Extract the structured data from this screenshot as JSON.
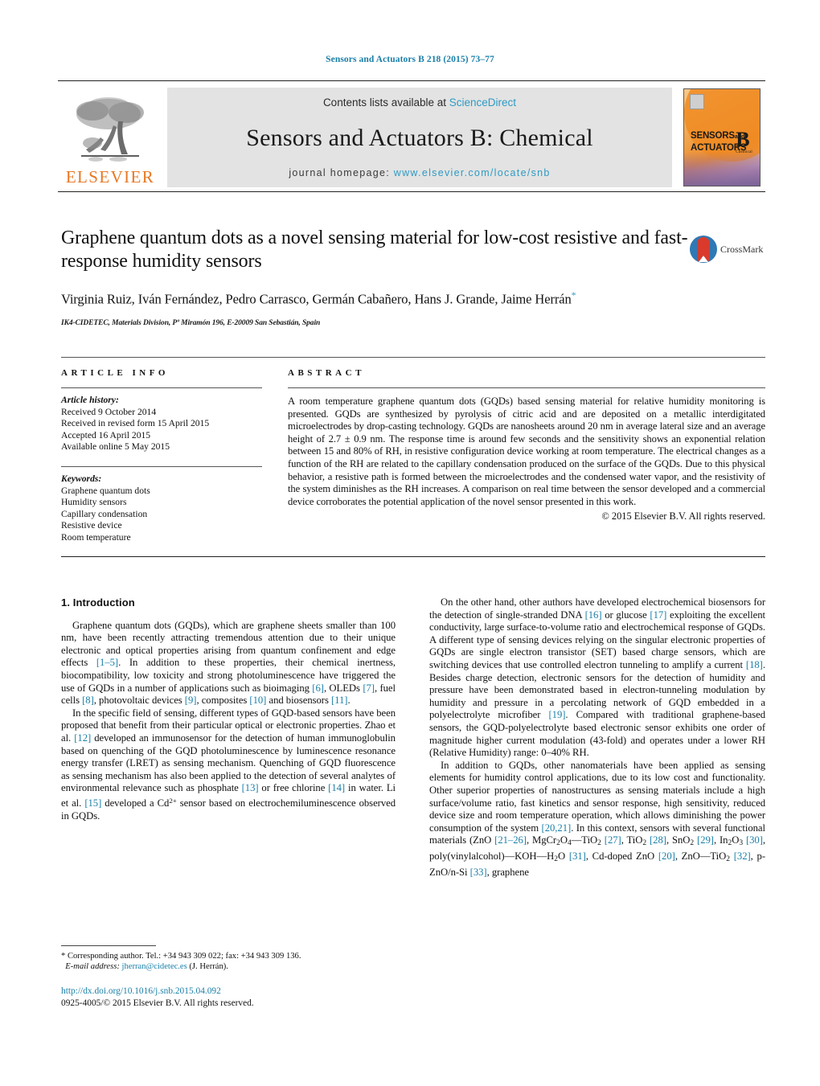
{
  "running_head": "Sensors and Actuators B 218 (2015) 73–77",
  "masthead": {
    "publisher_logo_text": "ELSEVIER",
    "contents_prefix": "Contents lists available at ",
    "contents_link": "ScienceDirect",
    "journal_title": "Sensors and Actuators B: Chemical",
    "homepage_prefix": "journal homepage: ",
    "homepage_url": "www.elsevier.com/locate/snb",
    "cover": {
      "line1": "SENSORS",
      "line1_suffix": "and",
      "line2": "ACTUATORS",
      "series": "B",
      "series_sub": "Chemical"
    }
  },
  "article": {
    "title": "Graphene quantum dots as a novel sensing material for low-cost resistive and fast-response humidity sensors",
    "authors": "Virginia Ruiz, Iván Fernández, Pedro Carrasco, Germán Cabañero, Hans J. Grande, Jaime Herrán",
    "corresponding_marker": "*",
    "affiliation": "IK4-CIDETEC, Materials Division, Pº Miramón 196, E-20009 San Sebastián, Spain",
    "crossmark_label": "CrossMark"
  },
  "article_info": {
    "heading": "ARTICLE INFO",
    "history_label": "Article history:",
    "history": [
      "Received 9 October 2014",
      "Received in revised form 15 April 2015",
      "Accepted 16 April 2015",
      "Available online 5 May 2015"
    ],
    "keywords_label": "Keywords:",
    "keywords": [
      "Graphene quantum dots",
      "Humidity sensors",
      "Capillary condensation",
      "Resistive device",
      "Room temperature"
    ]
  },
  "abstract": {
    "heading": "ABSTRACT",
    "text": "A room temperature graphene quantum dots (GQDs) based sensing material for relative humidity monitoring is presented. GQDs are synthesized by pyrolysis of citric acid and are deposited on a metallic interdigitated microelectrodes by drop-casting technology. GQDs are nanosheets around 20 nm in average lateral size and an average height of 2.7 ± 0.9 nm. The response time is around few seconds and the sensitivity shows an exponential relation between 15 and 80% of RH, in resistive configuration device working at room temperature. The electrical changes as a function of the RH are related to the capillary condensation produced on the surface of the GQDs. Due to this physical behavior, a resistive path is formed between the microelectrodes and the condensed water vapor, and the resistivity of the system diminishes as the RH increases. A comparison on real time between the sensor developed and a commercial device corroborates the potential application of the novel sensor presented in this work.",
    "copyright": "© 2015 Elsevier B.V. All rights reserved."
  },
  "body": {
    "section_title": "1.  Introduction",
    "left_p1_a": "Graphene quantum dots (GQDs), which are graphene sheets smaller than 100 nm, have been recently attracting tremendous attention due to their unique electronic and optical properties arising from quantum confinement and edge effects ",
    "left_p1_r1": "[1–5]",
    "left_p1_b": ". In addition to these properties, their chemical inertness, biocompatibility, low toxicity and strong photoluminescence have triggered the use of GQDs in a number of applications such as bioimaging ",
    "left_p1_r2": "[6]",
    "left_p1_c": ", OLEDs ",
    "left_p1_r3": "[7]",
    "left_p1_d": ", fuel cells ",
    "left_p1_r4": "[8]",
    "left_p1_e": ", photovoltaic devices ",
    "left_p1_r5": "[9]",
    "left_p1_f": ", composites ",
    "left_p1_r6": "[10]",
    "left_p1_g": " and biosensors ",
    "left_p1_r7": "[11]",
    "left_p1_h": ".",
    "left_p2_a": "In the specific field of sensing, different types of GQD-based sensors have been proposed that benefit from their particular optical or electronic properties. Zhao et al. ",
    "left_p2_r1": "[12]",
    "left_p2_b": " developed an immunosensor for the detection of human immunoglobulin based on quenching of the GQD photoluminescence by luminescence resonance energy transfer (LRET) as sensing mechanism. Quenching of GQD fluorescence as sensing mechanism has also been applied to the detection of several analytes of environmental relevance such as phosphate ",
    "left_p2_r2": "[13]",
    "left_p2_c": " or free chlorine ",
    "left_p2_r3": "[14]",
    "left_p2_d": " in water. Li et al. ",
    "left_p2_r4": "[15]",
    "left_p2_e": " developed a Cd",
    "left_p2_sup": "2+",
    "left_p2_f": " sensor based on electrochemiluminescence observed in GQDs.",
    "right_p1_a": "On the other hand, other authors have developed electrochemical biosensors for the detection of single-stranded DNA ",
    "right_p1_r1": "[16]",
    "right_p1_b": " or glucose ",
    "right_p1_r2": "[17]",
    "right_p1_c": " exploiting the excellent conductivity, large surface-to-volume ratio and electrochemical response of GQDs. A different type of sensing devices relying on the singular electronic properties of GQDs are single electron transistor (SET) based charge sensors, which are switching devices that use controlled electron tunneling to amplify a current ",
    "right_p1_r3": "[18]",
    "right_p1_d": ". Besides charge detection, electronic sensors for the detection of humidity and pressure have been demonstrated based in electron-tunneling modulation by humidity and pressure in a percolating network of GQD embedded in a polyelectrolyte microfiber ",
    "right_p1_r4": "[19]",
    "right_p1_e": ". Compared with traditional graphene-based sensors, the GQD-polyelectrolyte based electronic sensor exhibits one order of magnitude higher current modulation (43-fold) and operates under a lower RH (Relative Humidity) range: 0–40% RH.",
    "right_p2_a": "In addition to GQDs, other nanomaterials have been applied as sensing elements for humidity control applications, due to its low cost and functionality. Other superior properties of nanostructures as sensing materials include a high surface/volume ratio, fast kinetics and sensor response, high sensitivity, reduced device size and room temperature operation, which allows diminishing the power consumption of the system ",
    "right_p2_r1": "[20,21]",
    "right_p2_b": ". In this context, sensors with several functional materials (ZnO ",
    "right_p2_r2": "[21–26]",
    "right_p2_c": ", MgCr",
    "right_p2_d": "O",
    "right_p2_e": "—TiO",
    "right_p2_r3": "[27]",
    "right_p2_f": ", TiO",
    "right_p2_r4": "[28]",
    "right_p2_g": ", SnO",
    "right_p2_r5": "[29]",
    "right_p2_h": ", In",
    "right_p2_i": "O",
    "right_p2_r6": "[30]",
    "right_p2_j": ", poly(vinylalcohol)—KOH—H",
    "right_p2_k": "O ",
    "right_p2_r7": "[31]",
    "right_p2_l": ", Cd-doped ZnO ",
    "right_p2_r8": "[20]",
    "right_p2_m": ", ZnO—TiO",
    "right_p2_r9": "[32]",
    "right_p2_n": ", p-ZnO/n-Si ",
    "right_p2_r10": "[33]",
    "right_p2_o": ", graphene"
  },
  "footnote": {
    "marker": "*",
    "corresponding": "  Corresponding author. Tel.: +34 943 309 022; fax: +34 943 309 136.",
    "email_label": "E-mail address:",
    "email": "jherran@cidetec.es",
    "email_suffix": " (J. Herrán)."
  },
  "footer": {
    "doi": "http://dx.doi.org/10.1016/j.snb.2015.04.092",
    "issn_line": "0925-4005/© 2015 Elsevier B.V. All rights reserved."
  },
  "colors": {
    "link": "#1a7fa8",
    "sciencedirect": "#2e9bc4",
    "elsevier_orange": "#e87722",
    "band_gray": "#e3e3e3"
  }
}
